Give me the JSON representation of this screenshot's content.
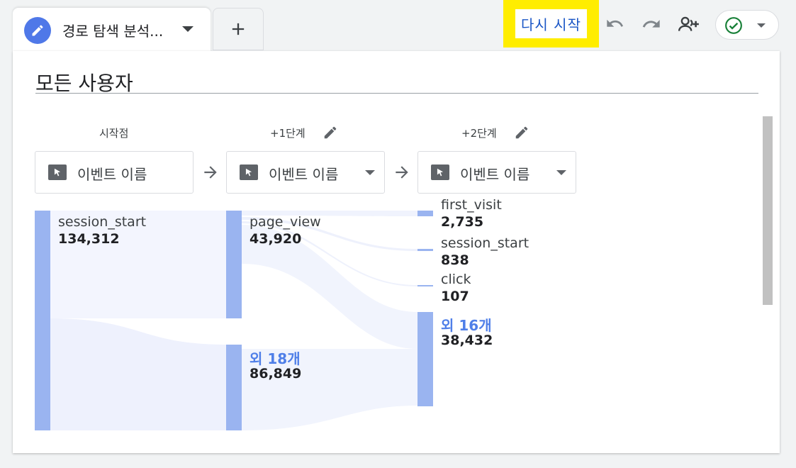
{
  "tab": {
    "title": "경로 탐색 분석..."
  },
  "toolbar": {
    "restart_label": "다시 시작"
  },
  "segment": {
    "title": "모든 사용자"
  },
  "steps": [
    {
      "label": "시작점",
      "selector": "이벤트 이름"
    },
    {
      "label": "+1단계",
      "selector": "이벤트 이름"
    },
    {
      "label": "+2단계",
      "selector": "이벤트 이름"
    }
  ],
  "nodes": {
    "col0": [
      {
        "name": "session_start",
        "value": "134,312"
      }
    ],
    "col1": [
      {
        "name": "page_view",
        "value": "43,920"
      },
      {
        "name": "외 18개",
        "value": "86,849"
      }
    ],
    "col2": [
      {
        "name": "first_visit",
        "value": "2,735"
      },
      {
        "name": "session_start",
        "value": "838"
      },
      {
        "name": "click",
        "value": "107"
      },
      {
        "name": "외 16개",
        "value": "38,432"
      }
    ]
  },
  "colors": {
    "accent": "#4f78e8",
    "node_bar": "#9ab4f0",
    "flow": "#eef1fd",
    "highlight": "#ffed00"
  },
  "icons": [
    "pencil-icon",
    "plus-icon",
    "undo-icon",
    "redo-icon",
    "add-person-icon",
    "check-circle-icon",
    "cursor-icon",
    "arrow-right-icon"
  ]
}
